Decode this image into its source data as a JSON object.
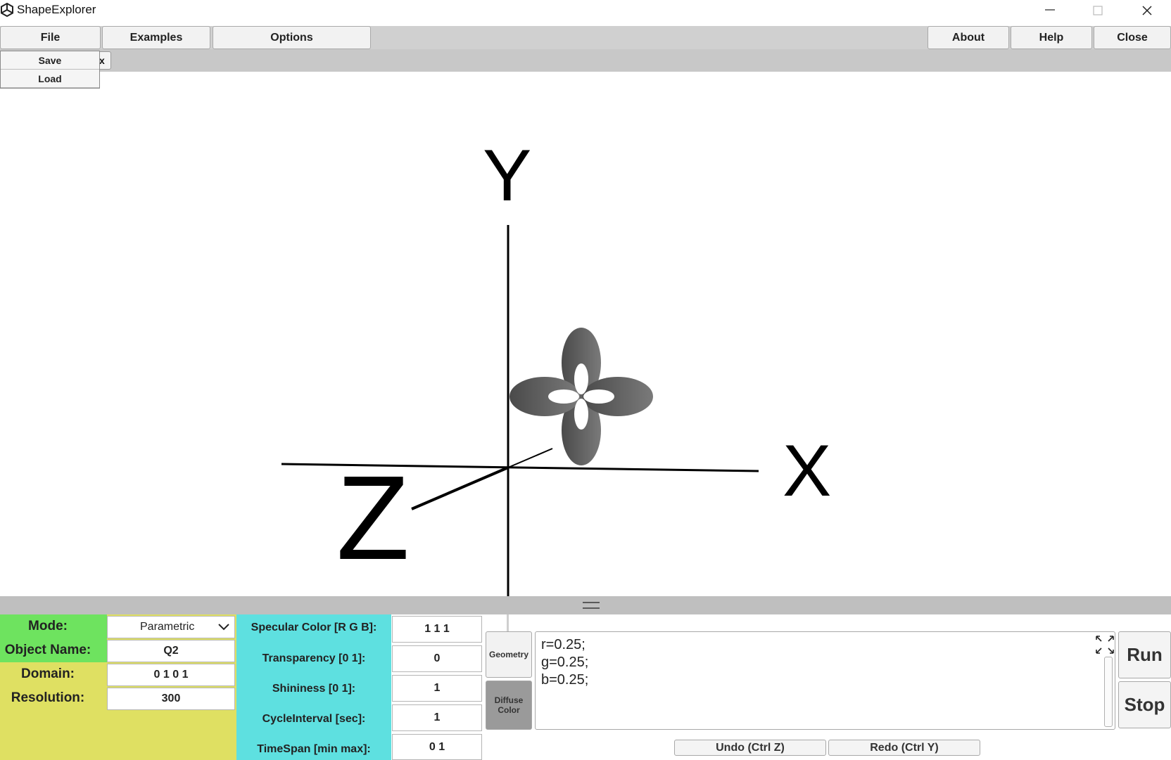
{
  "window": {
    "title": "ShapeExplorer",
    "minimize_icon": "minimize-icon",
    "maximize_icon": "maximize-icon",
    "close_icon": "close-icon"
  },
  "menu": {
    "file": "File",
    "examples": "Examples",
    "options": "Options",
    "about": "About",
    "help": "Help",
    "close": "Close"
  },
  "file_menu": {
    "items": [
      "Save",
      "Load"
    ]
  },
  "toolbar": {
    "tab_fragment": "x"
  },
  "viewport": {
    "axis_x": "X",
    "axis_y": "Y",
    "axis_z": "Z",
    "shape_color": "#555555"
  },
  "params": {
    "mode_label": "Mode:",
    "mode_value": "Parametric",
    "object_name_label": "Object Name:",
    "object_name_value": "Q2",
    "domain_label": "Domain:",
    "domain_value": "0 1 0 1",
    "resolution_label": "Resolution:",
    "resolution_value": "300"
  },
  "material": {
    "specular_label": "Specular Color [R G B]:",
    "specular_value": "1 1 1",
    "transparency_label": "Transparency [0 1]:",
    "transparency_value": "0",
    "shininess_label": "Shininess [0 1]:",
    "shininess_value": "1",
    "cycle_label": "CycleInterval [sec]:",
    "cycle_value": "1",
    "timespan_label": "TimeSpan [min max]:",
    "timespan_value": "0 1"
  },
  "editor": {
    "geometry_tab": "Geometry",
    "diffuse_tab": "Diffuse Color",
    "code_lines": [
      "r=0.25;",
      "g=0.25;",
      "b=0.25;"
    ],
    "run": "Run",
    "stop": "Stop",
    "undo": "Undo (Ctrl Z)",
    "redo": "Redo (Ctrl Y)"
  },
  "colors": {
    "mode_panel": "#6ee35f",
    "param_panel": "#dfe062",
    "material_panel": "#5ee0e0"
  }
}
